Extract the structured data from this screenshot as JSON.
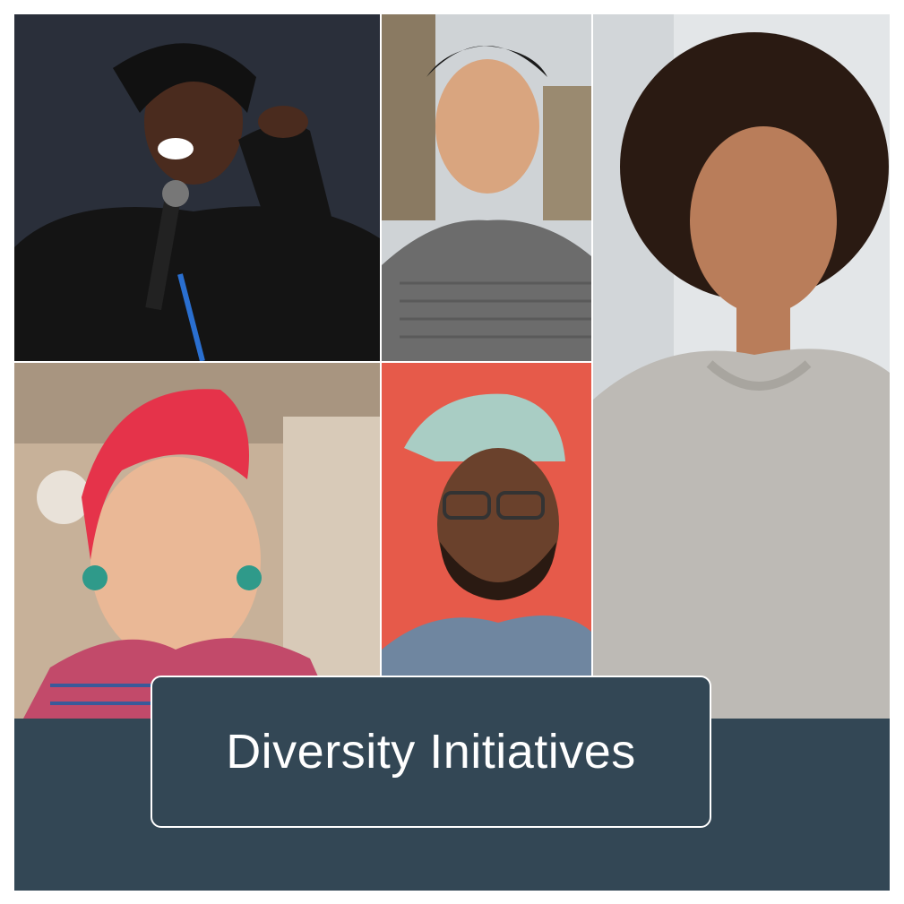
{
  "banner": {
    "title": "Diversity Initiatives",
    "background_color": "#334755",
    "text_color": "#ffffff"
  },
  "photos": [
    {
      "subject": "woman speaking into microphone, pointing",
      "icon": "person-photo"
    },
    {
      "subject": "man in grey striped shirt",
      "icon": "person-photo"
    },
    {
      "subject": "smiling woman with curly hair in grey sweater",
      "icon": "person-photo"
    },
    {
      "subject": "smiling woman with red undercut hair and earrings",
      "icon": "person-photo"
    },
    {
      "subject": "smiling man in cap and glasses on red background",
      "icon": "person-photo"
    }
  ]
}
